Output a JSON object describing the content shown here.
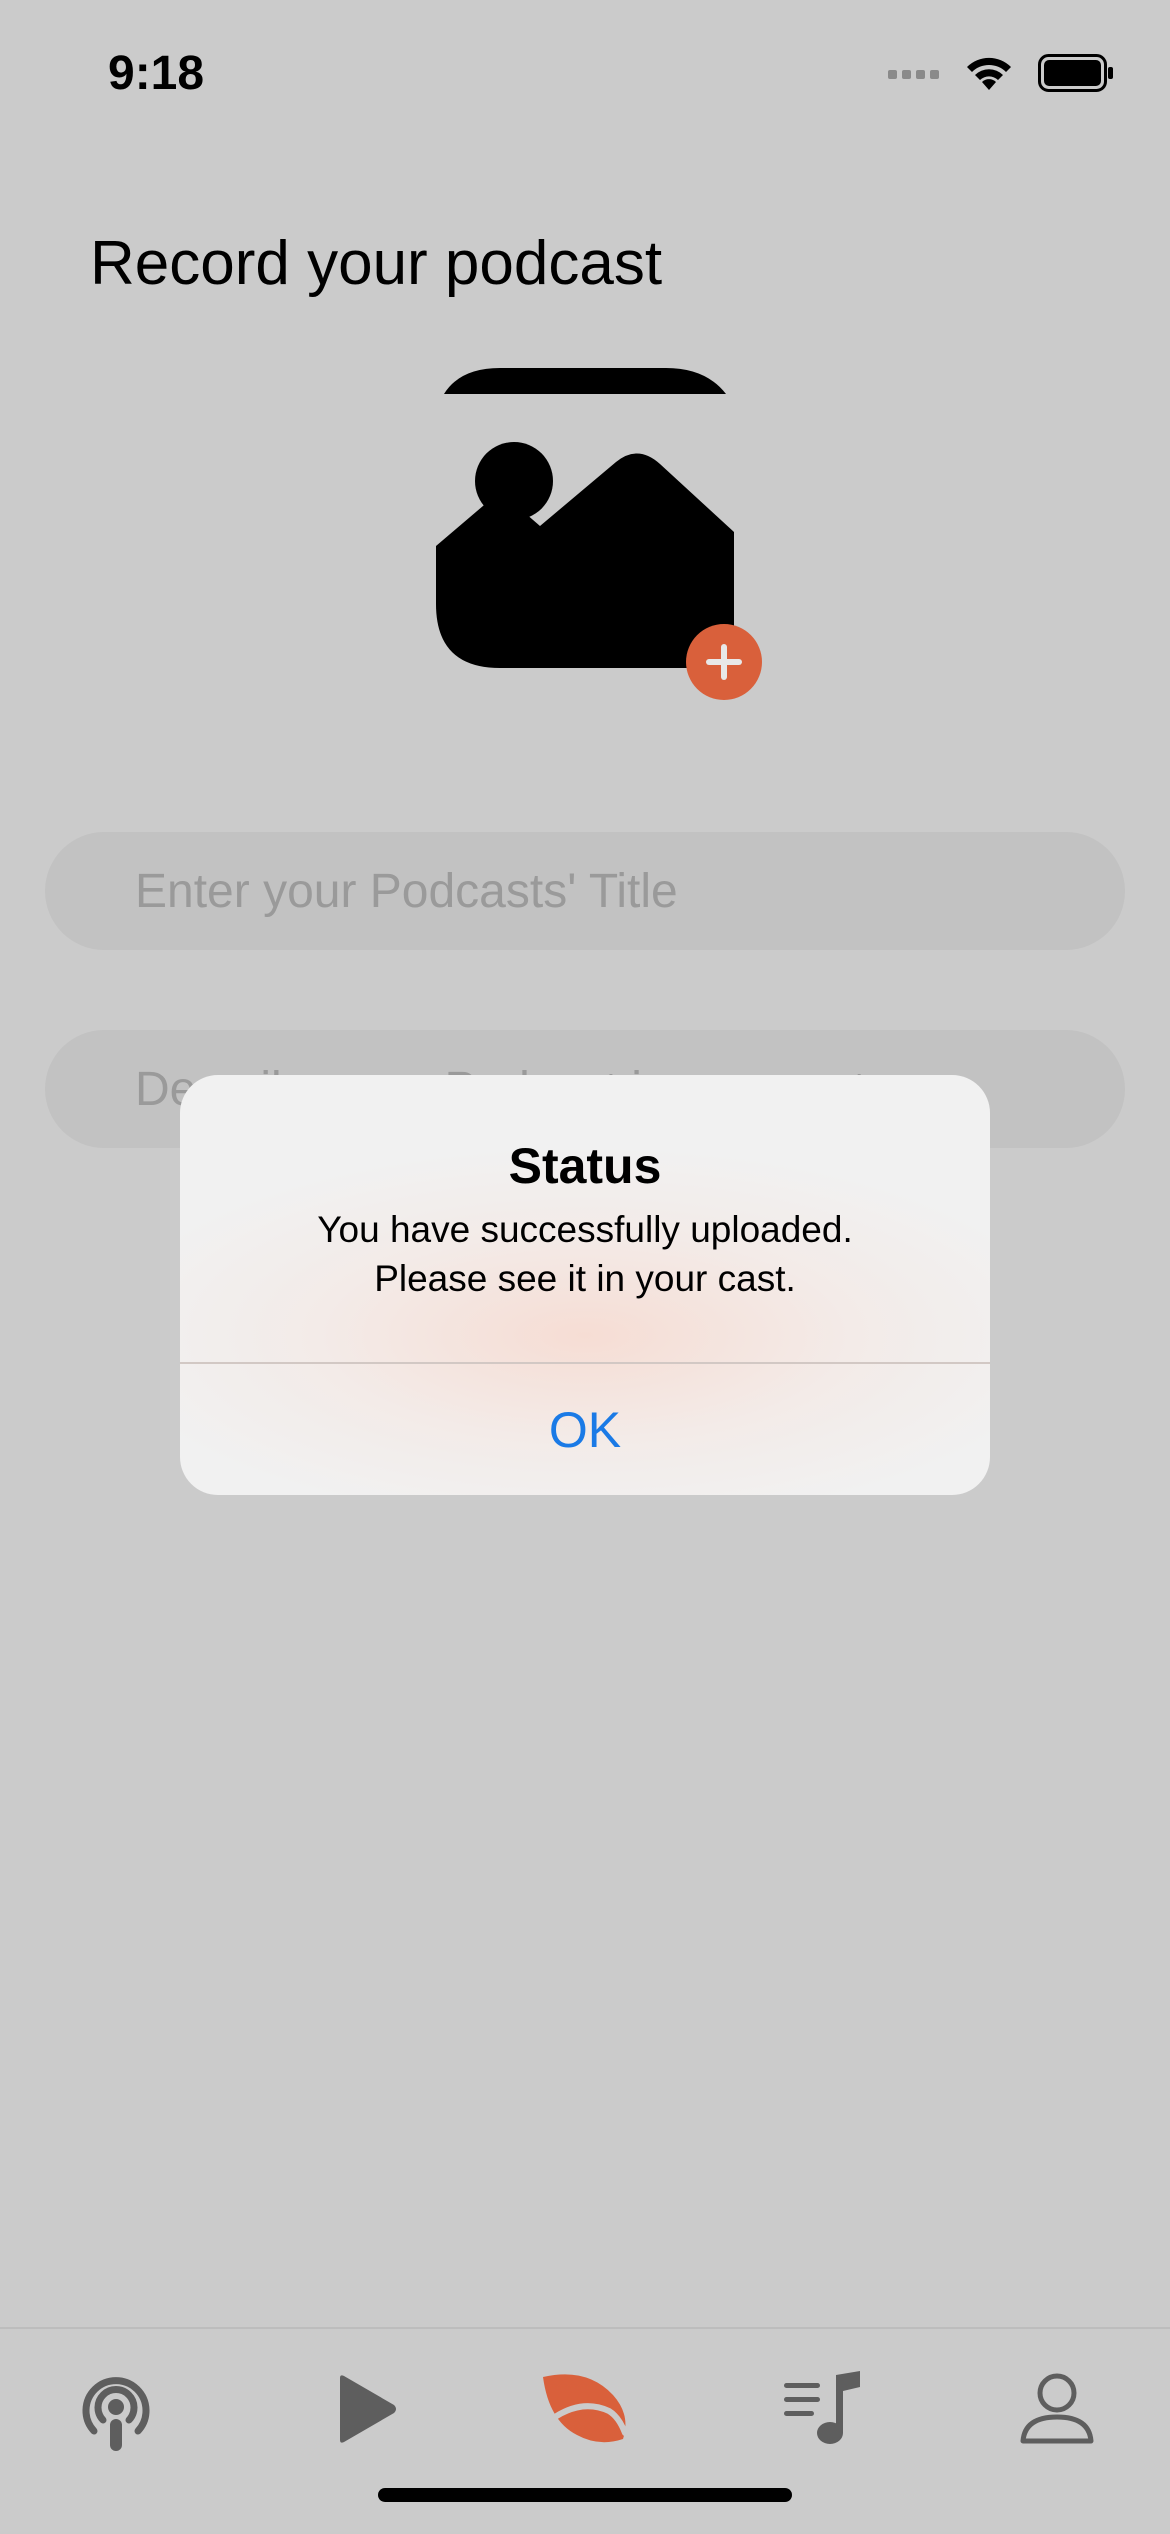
{
  "status_bar": {
    "time": "9:18"
  },
  "page": {
    "title": "Record your podcast"
  },
  "form": {
    "title_placeholder": "Enter your Podcasts' Title",
    "description_placeholder": "Describe your Podcast in one sentence"
  },
  "dialog": {
    "title": "Status",
    "message_line1": "You have successfully uploaded.",
    "message_line2": "Please see it in your cast.",
    "ok_label": "OK"
  },
  "tab_bar": {
    "tabs": [
      {
        "icon": "podcast-icon",
        "active": false
      },
      {
        "icon": "play-icon",
        "active": false
      },
      {
        "icon": "leaf-icon",
        "active": true
      },
      {
        "icon": "playlist-icon",
        "active": false
      },
      {
        "icon": "person-icon",
        "active": false
      }
    ]
  },
  "colors": {
    "accent": "#d9603b",
    "link": "#1a7ae6",
    "background": "#cbcbcb",
    "icon_inactive": "#5e5e5e"
  }
}
